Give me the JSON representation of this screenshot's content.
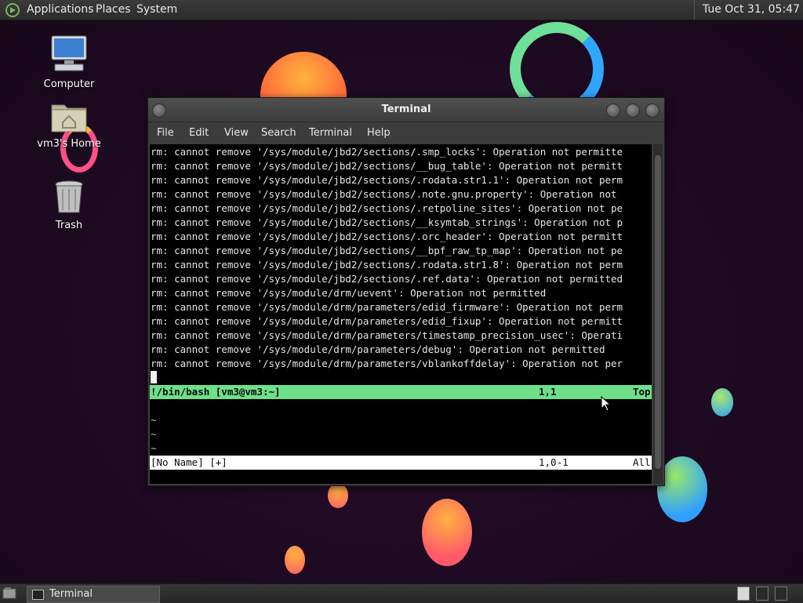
{
  "top_panel": {
    "menus": [
      "Applications",
      "Places",
      "System"
    ],
    "clock": "Tue Oct 31, 05:47"
  },
  "desktop": {
    "icons": [
      {
        "label": "Computer"
      },
      {
        "label": "vm3's Home"
      },
      {
        "label": "Trash"
      }
    ]
  },
  "window": {
    "title": "Terminal",
    "menubar": [
      "File",
      "Edit",
      "View",
      "Search",
      "Terminal",
      "Help"
    ],
    "terminal_lines": [
      "rm: cannot remove '/sys/module/jbd2/sections/.smp_locks': Operation not permitte",
      "rm: cannot remove '/sys/module/jbd2/sections/__bug_table': Operation not permitt",
      "rm: cannot remove '/sys/module/jbd2/sections/.rodata.str1.1': Operation not perm",
      "rm: cannot remove '/sys/module/jbd2/sections/.note.gnu.property': Operation not ",
      "rm: cannot remove '/sys/module/jbd2/sections/.retpoline_sites': Operation not pe",
      "rm: cannot remove '/sys/module/jbd2/sections/__ksymtab_strings': Operation not p",
      "rm: cannot remove '/sys/module/jbd2/sections/.orc_header': Operation not permitt",
      "rm: cannot remove '/sys/module/jbd2/sections/__bpf_raw_tp_map': Operation not pe",
      "rm: cannot remove '/sys/module/jbd2/sections/.rodata.str1.8': Operation not perm",
      "rm: cannot remove '/sys/module/jbd2/sections/.ref.data': Operation not permitted",
      "rm: cannot remove '/sys/module/drm/uevent': Operation not permitted",
      "rm: cannot remove '/sys/module/drm/parameters/edid_firmware': Operation not perm",
      "rm: cannot remove '/sys/module/drm/parameters/edid_fixup': Operation not permitt",
      "rm: cannot remove '/sys/module/drm/parameters/timestamp_precision_usec': Operati",
      "rm: cannot remove '/sys/module/drm/parameters/debug': Operation not permitted",
      "rm: cannot remove '/sys/module/drm/parameters/vblankoffdelay': Operation not per"
    ],
    "status_top": {
      "name": "!/bin/bash [vm3@vm3:~]",
      "position": "1,1",
      "scroll": "Top"
    },
    "tildes": [
      "~",
      "~",
      "~"
    ],
    "status_bottom": {
      "name": "[No Name] [+]",
      "position": "1,0-1",
      "scroll": "All"
    }
  },
  "bottom_panel": {
    "task_label": "Terminal"
  }
}
